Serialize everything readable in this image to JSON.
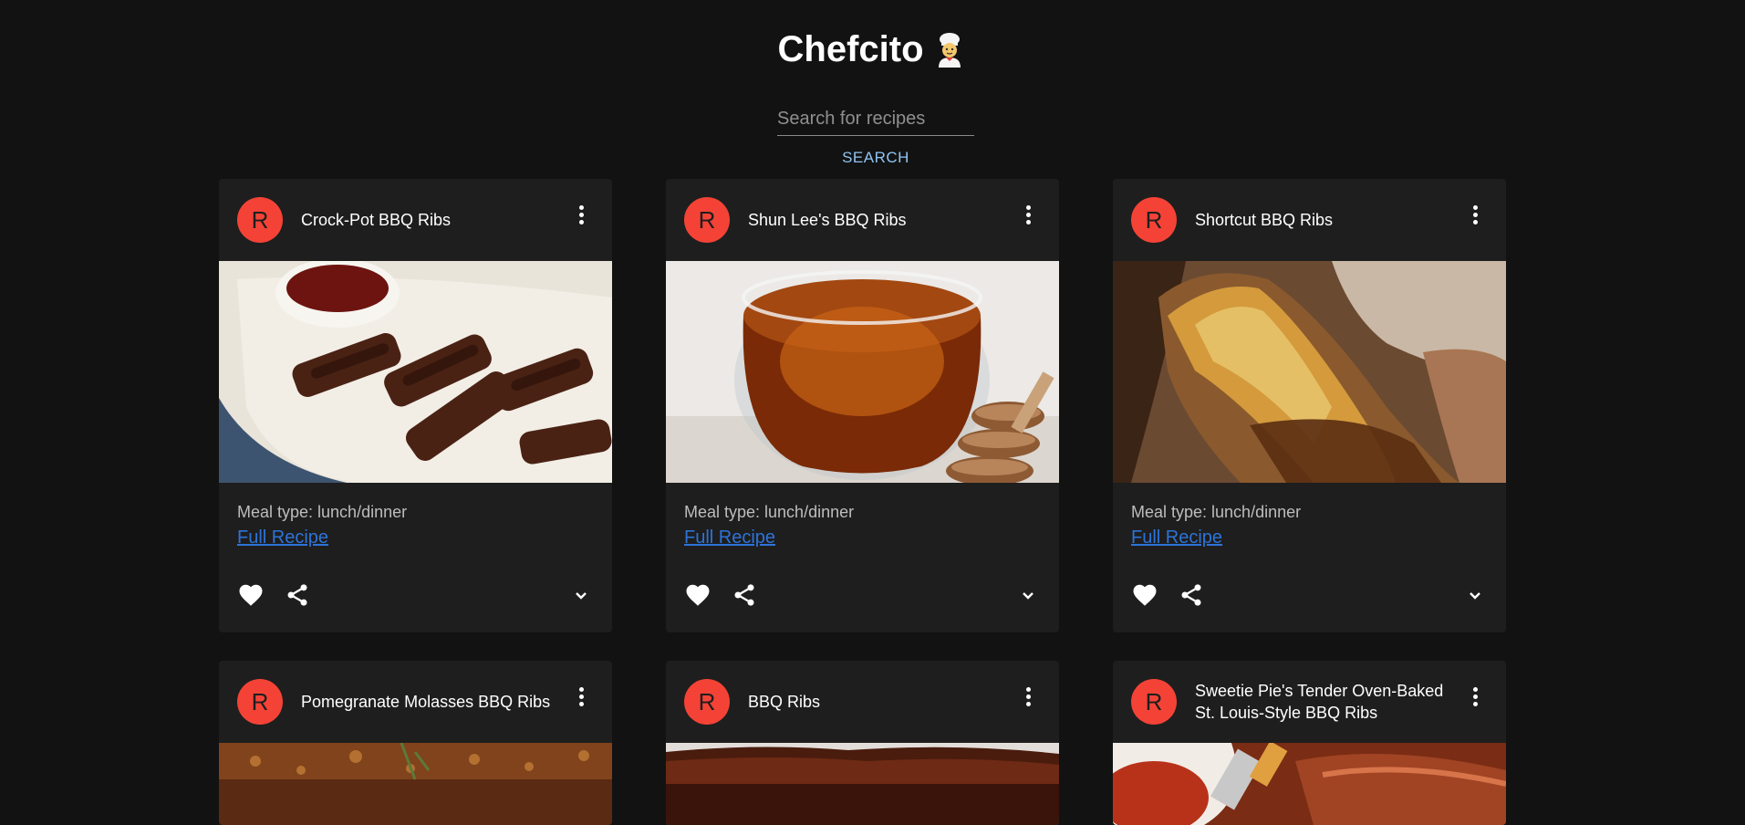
{
  "app": {
    "title": "Chefcito",
    "title_emoji_icon": "chef-emoji-icon"
  },
  "search": {
    "placeholder": "Search for recipes",
    "value": "",
    "button_label": "SEARCH"
  },
  "colors": {
    "background": "#121212",
    "card": "#1e1e1e",
    "avatar": "#f44336",
    "link": "#2d73d9",
    "search_button": "#8fc4f4"
  },
  "cards": [
    {
      "avatar_letter": "R",
      "title": "Crock-Pot BBQ Ribs",
      "meal_type": "Meal type: lunch/dinner",
      "link_label": "Full Recipe"
    },
    {
      "avatar_letter": "R",
      "title": "Shun Lee's BBQ Ribs",
      "meal_type": "Meal type: lunch/dinner",
      "link_label": "Full Recipe"
    },
    {
      "avatar_letter": "R",
      "title": "Shortcut BBQ Ribs",
      "meal_type": "Meal type: lunch/dinner",
      "link_label": "Full Recipe"
    },
    {
      "avatar_letter": "R",
      "title": "Pomegranate Molasses BBQ Ribs"
    },
    {
      "avatar_letter": "R",
      "title": "BBQ Ribs"
    },
    {
      "avatar_letter": "R",
      "title": "Sweetie Pie's Tender Oven-Baked St. Louis-Style BBQ Ribs"
    }
  ],
  "icons": {
    "more": "more-vert-icon",
    "favorite": "heart-icon",
    "share": "share-icon",
    "expand": "chevron-down-icon"
  }
}
